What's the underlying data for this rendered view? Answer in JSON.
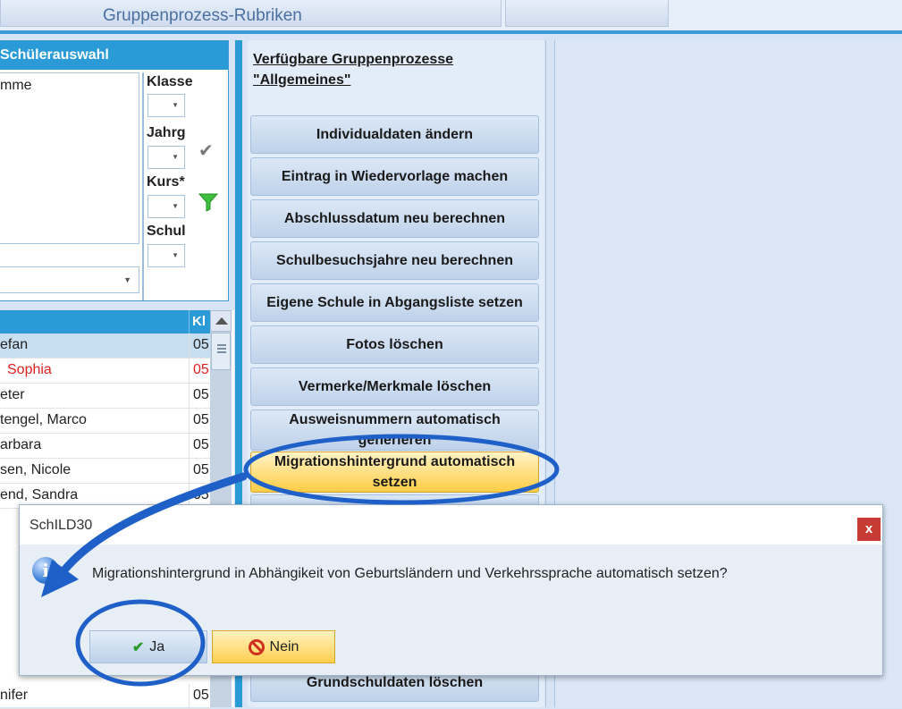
{
  "tabs": {
    "main_label": "Gruppenprozess-Rubriken"
  },
  "left_panel": {
    "header": "Schülerauswahl",
    "list_text": "mme",
    "filters": [
      {
        "label": "Klasse"
      },
      {
        "label": "Jahrg"
      },
      {
        "label": "Kurs*"
      },
      {
        "label": "Schul"
      }
    ]
  },
  "student_grid": {
    "header_class": "Kl",
    "rows": [
      {
        "name": "efan",
        "class": "05"
      },
      {
        "name": "Sophia",
        "class": "05"
      },
      {
        "name": "eter",
        "class": "05"
      },
      {
        "name": "tengel, Marco",
        "class": "05"
      },
      {
        "name": "arbara",
        "class": "05"
      },
      {
        "name": "sen, Nicole",
        "class": "05"
      },
      {
        "name": "end, Sandra",
        "class": "05"
      },
      {
        "name": "nifer",
        "class": "05"
      }
    ]
  },
  "processes": {
    "title_line1": "Verfügbare Gruppenprozesse",
    "title_line2": "\"Allgemeines\"",
    "buttons": [
      {
        "label": "Individualdaten ändern"
      },
      {
        "label": "Eintrag in Wiedervorlage machen"
      },
      {
        "label": "Abschlussdatum neu berechnen"
      },
      {
        "label": "Schulbesuchsjahre neu berechnen"
      },
      {
        "label": "Eigene Schule in Abgangsliste setzen"
      },
      {
        "label": "Fotos löschen"
      },
      {
        "label": "Vermerke/Merkmale löschen"
      },
      {
        "label": "Ausweisnummern automatisch generieren"
      },
      {
        "label": "Migrationshintergrund automatisch setzen"
      },
      {
        "label": "Grundschuldaten löschen"
      }
    ]
  },
  "dialog": {
    "title": "SchILD30",
    "message": "Migrationshintergrund in Abhängikeit von Geburtsländern und Verkehrssprache automatisch setzen?",
    "yes_label": "Ja",
    "no_label": "Nein",
    "close_label": "x"
  },
  "colors": {
    "accent": "#2b9bd8",
    "highlight": "#ffcd45",
    "annotation": "#1e5fc8"
  }
}
